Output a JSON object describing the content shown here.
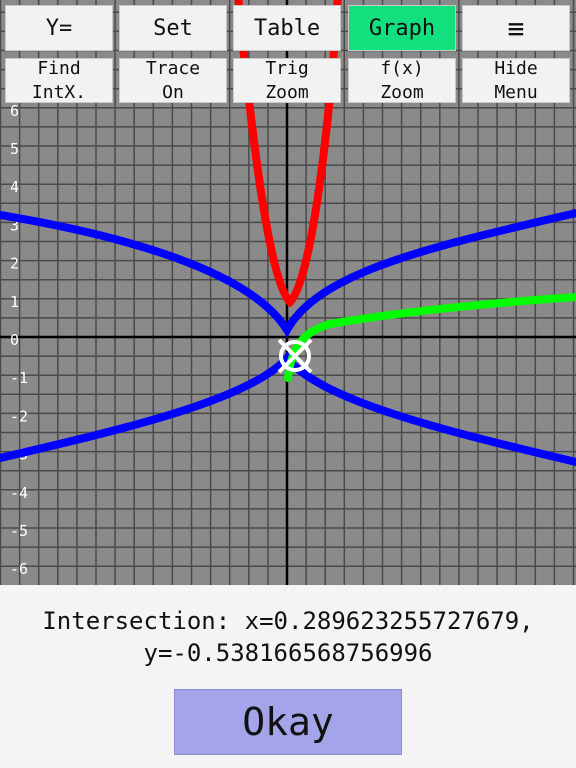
{
  "toolbar": {
    "buttons": [
      {
        "label": "Y="
      },
      {
        "label": "Set"
      },
      {
        "label": "Table"
      },
      {
        "label": "Graph",
        "active": true
      },
      {
        "label": "≡",
        "icon": "hamburger-menu-icon"
      }
    ],
    "sub_buttons": [
      {
        "line1": "Find",
        "line2": "IntX."
      },
      {
        "line1": "Trace",
        "line2": "On"
      },
      {
        "line1": "Trig",
        "line2": "Zoom"
      },
      {
        "line1": "f(x)",
        "line2": "Zoom"
      },
      {
        "line1": "Hide",
        "line2": "Menu"
      }
    ]
  },
  "graph": {
    "y_tick_labels": [
      "6",
      "5",
      "4",
      "3",
      "2",
      "1",
      "0",
      "-1",
      "-2",
      "-3",
      "-4",
      "-5",
      "-6"
    ],
    "colors": {
      "background": "#8a8a8a",
      "grid": "#4a4a4a",
      "axes": "#000000",
      "red": "#ff0000",
      "blue": "#0000ff",
      "green": "#00ff00"
    },
    "intersection_marker": "crosshair-target-icon"
  },
  "dialog": {
    "line1": "Intersection: x=0.289623255727679,",
    "line2": "y=-0.538166568756996",
    "okay_label": "Okay"
  }
}
